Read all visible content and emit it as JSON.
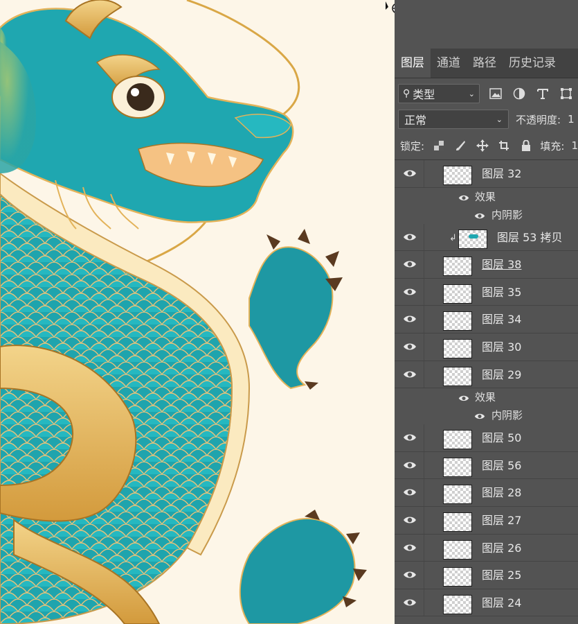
{
  "panel": {
    "tabs": [
      "图层",
      "通道",
      "路径",
      "历史记录"
    ],
    "active_tab": 0,
    "filter_kind_label": "类型",
    "blend_mode": "正常",
    "opacity_label": "不透明度:",
    "opacity_value": "1",
    "lock_label": "锁定:",
    "fill_label": "填充:",
    "fill_value": "1"
  },
  "layers": [
    {
      "type": "layer",
      "name": "图层 32"
    },
    {
      "type": "effects",
      "label": "效果"
    },
    {
      "type": "effect",
      "label": "内阴影"
    },
    {
      "type": "layer",
      "name": "图层 53 拷贝",
      "clipped": true
    },
    {
      "type": "layer",
      "name": "图层 38",
      "underline": true
    },
    {
      "type": "layer",
      "name": "图层 35"
    },
    {
      "type": "layer",
      "name": "图层 34"
    },
    {
      "type": "layer",
      "name": "图层 30"
    },
    {
      "type": "layer",
      "name": "图层 29"
    },
    {
      "type": "effects",
      "label": "效果"
    },
    {
      "type": "effect",
      "label": "内阴影"
    },
    {
      "type": "layer",
      "name": "图层 50"
    },
    {
      "type": "layer",
      "name": "图层 56"
    },
    {
      "type": "layer",
      "name": "图层 28"
    },
    {
      "type": "layer",
      "name": "图层 27"
    },
    {
      "type": "layer",
      "name": "图层 26"
    },
    {
      "type": "layer",
      "name": "图层 25"
    },
    {
      "type": "layer",
      "name": "图层 24"
    }
  ],
  "colors": {
    "canvas_bg": "#fdf6e8",
    "dragon_teal": "#1ea7b0",
    "dragon_gold": "#e3b35a",
    "panel_bg": "#535353",
    "tab_bar_bg": "#424242"
  }
}
